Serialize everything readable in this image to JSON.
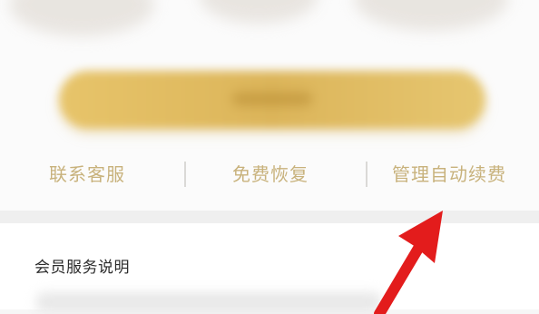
{
  "links": {
    "contact_service": "联系客服",
    "free_restore": "免费恢复",
    "manage_auto_renew": "管理自动续费"
  },
  "section": {
    "title": "会员服务说明"
  },
  "colors": {
    "gold_button": "#dcb55a",
    "link_text": "#c8b27c",
    "arrow": "#e31c1c"
  },
  "icons": {
    "arrow": "red-arrow-icon"
  }
}
